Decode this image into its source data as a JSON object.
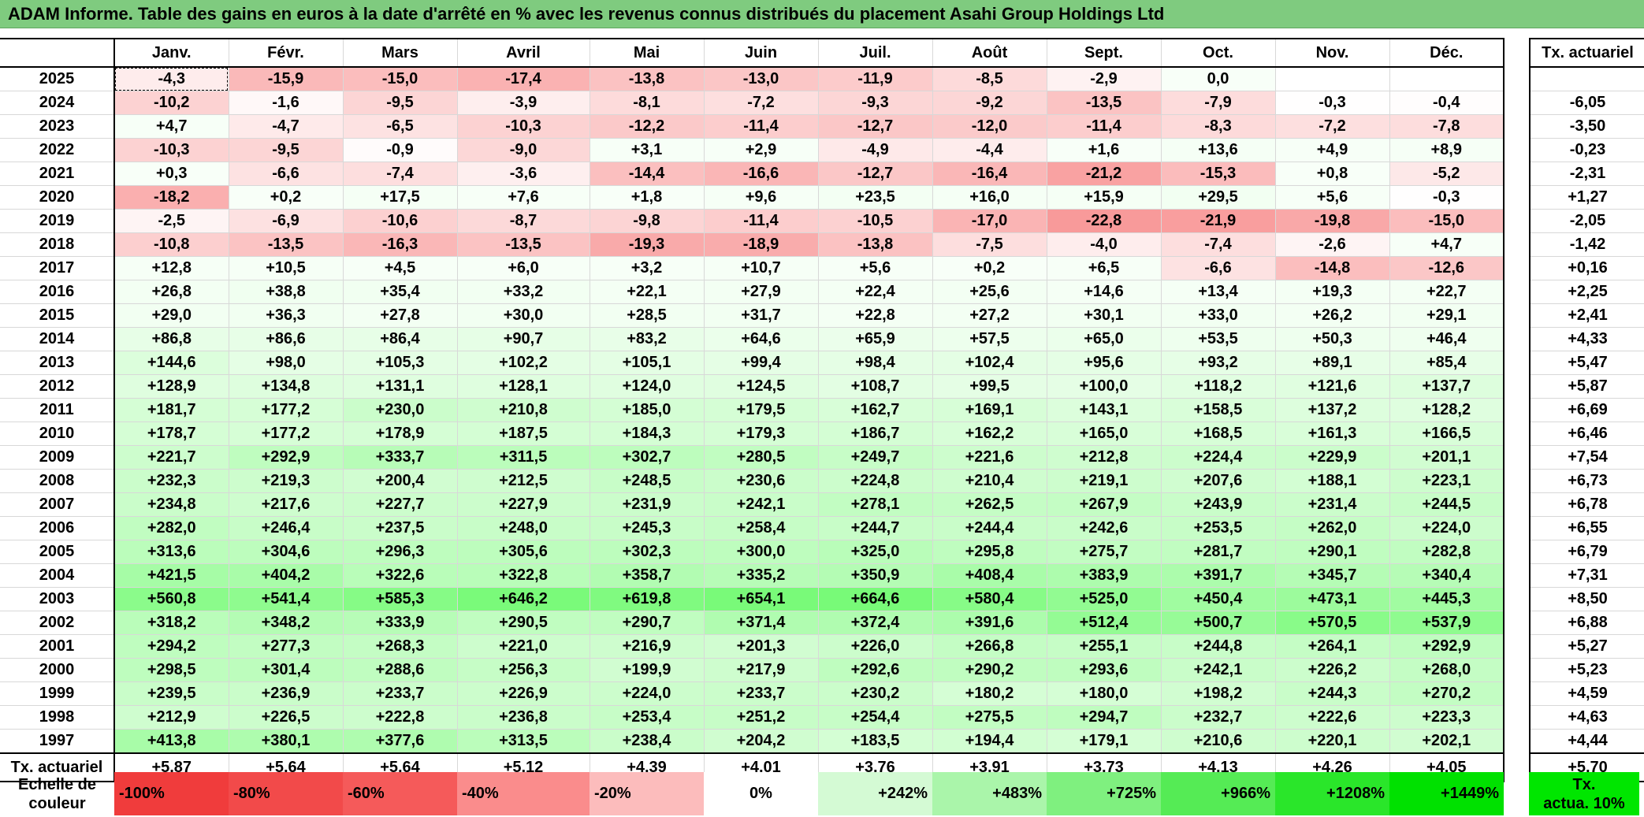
{
  "title": "ADAM Informe. Table des gains en euros à la date d'arrêté en % avec les revenus connus distribués du placement Asahi Group Holdings Ltd",
  "months": [
    "Janv.",
    "Févr.",
    "Mars",
    "Avril",
    "Mai",
    "Juin",
    "Juil.",
    "Août",
    "Sept.",
    "Oct.",
    "Nov.",
    "Déc."
  ],
  "actuarial_header": "Tx. actuariel",
  "rows": [
    {
      "year": "2025",
      "values": [
        "-4,3",
        "-15,9",
        "-15,0",
        "-17,4",
        "-13,8",
        "-13,0",
        "-11,9",
        "-8,5",
        "-2,9",
        "0,0",
        "",
        ""
      ],
      "rate": ""
    },
    {
      "year": "2024",
      "values": [
        "-10,2",
        "-1,6",
        "-9,5",
        "-3,9",
        "-8,1",
        "-7,2",
        "-9,3",
        "-9,2",
        "-13,5",
        "-7,9",
        "-0,3",
        "-0,4"
      ],
      "rate": "-6,05"
    },
    {
      "year": "2023",
      "values": [
        "+4,7",
        "-4,7",
        "-6,5",
        "-10,3",
        "-12,2",
        "-11,4",
        "-12,7",
        "-12,0",
        "-11,4",
        "-8,3",
        "-7,2",
        "-7,8"
      ],
      "rate": "-3,50"
    },
    {
      "year": "2022",
      "values": [
        "-10,3",
        "-9,5",
        "-0,9",
        "-9,0",
        "+3,1",
        "+2,9",
        "-4,9",
        "-4,4",
        "+1,6",
        "+13,6",
        "+4,9",
        "+8,9"
      ],
      "rate": "-0,23"
    },
    {
      "year": "2021",
      "values": [
        "+0,3",
        "-6,6",
        "-7,4",
        "-3,6",
        "-14,4",
        "-16,6",
        "-12,7",
        "-16,4",
        "-21,2",
        "-15,3",
        "+0,8",
        "-5,2"
      ],
      "rate": "-2,31"
    },
    {
      "year": "2020",
      "values": [
        "-18,2",
        "+0,2",
        "+17,5",
        "+7,6",
        "+1,8",
        "+9,6",
        "+23,5",
        "+16,0",
        "+15,9",
        "+29,5",
        "+5,6",
        "-0,3"
      ],
      "rate": "+1,27"
    },
    {
      "year": "2019",
      "values": [
        "-2,5",
        "-6,9",
        "-10,6",
        "-8,7",
        "-9,8",
        "-11,4",
        "-10,5",
        "-17,0",
        "-22,8",
        "-21,9",
        "-19,8",
        "-15,0"
      ],
      "rate": "-2,05"
    },
    {
      "year": "2018",
      "values": [
        "-10,8",
        "-13,5",
        "-16,3",
        "-13,5",
        "-19,3",
        "-18,9",
        "-13,8",
        "-7,5",
        "-4,0",
        "-7,4",
        "-2,6",
        "+4,7"
      ],
      "rate": "-1,42"
    },
    {
      "year": "2017",
      "values": [
        "+12,8",
        "+10,5",
        "+4,5",
        "+6,0",
        "+3,2",
        "+10,7",
        "+5,6",
        "+0,2",
        "+6,5",
        "-6,6",
        "-14,8",
        "-12,6"
      ],
      "rate": "+0,16"
    },
    {
      "year": "2016",
      "values": [
        "+26,8",
        "+38,8",
        "+35,4",
        "+33,2",
        "+22,1",
        "+27,9",
        "+22,4",
        "+25,6",
        "+14,6",
        "+13,4",
        "+19,3",
        "+22,7"
      ],
      "rate": "+2,25"
    },
    {
      "year": "2015",
      "values": [
        "+29,0",
        "+36,3",
        "+27,8",
        "+30,0",
        "+28,5",
        "+31,7",
        "+22,8",
        "+27,2",
        "+30,1",
        "+33,0",
        "+26,2",
        "+29,1"
      ],
      "rate": "+2,41"
    },
    {
      "year": "2014",
      "values": [
        "+86,8",
        "+86,6",
        "+86,4",
        "+90,7",
        "+83,2",
        "+64,6",
        "+65,9",
        "+57,5",
        "+65,0",
        "+53,5",
        "+50,3",
        "+46,4"
      ],
      "rate": "+4,33"
    },
    {
      "year": "2013",
      "values": [
        "+144,6",
        "+98,0",
        "+105,3",
        "+102,2",
        "+105,1",
        "+99,4",
        "+98,4",
        "+102,4",
        "+95,6",
        "+93,2",
        "+89,1",
        "+85,4"
      ],
      "rate": "+5,47"
    },
    {
      "year": "2012",
      "values": [
        "+128,9",
        "+134,8",
        "+131,1",
        "+128,1",
        "+124,0",
        "+124,5",
        "+108,7",
        "+99,5",
        "+100,0",
        "+118,2",
        "+121,6",
        "+137,7"
      ],
      "rate": "+5,87"
    },
    {
      "year": "2011",
      "values": [
        "+181,7",
        "+177,2",
        "+230,0",
        "+210,8",
        "+185,0",
        "+179,5",
        "+162,7",
        "+169,1",
        "+143,1",
        "+158,5",
        "+137,2",
        "+128,2"
      ],
      "rate": "+6,69"
    },
    {
      "year": "2010",
      "values": [
        "+178,7",
        "+177,2",
        "+178,9",
        "+187,5",
        "+184,3",
        "+179,3",
        "+186,7",
        "+162,2",
        "+165,0",
        "+168,5",
        "+161,3",
        "+166,5"
      ],
      "rate": "+6,46"
    },
    {
      "year": "2009",
      "values": [
        "+221,7",
        "+292,9",
        "+333,7",
        "+311,5",
        "+302,7",
        "+280,5",
        "+249,7",
        "+221,6",
        "+212,8",
        "+224,4",
        "+229,9",
        "+201,1"
      ],
      "rate": "+7,54"
    },
    {
      "year": "2008",
      "values": [
        "+232,3",
        "+219,3",
        "+200,4",
        "+212,5",
        "+248,5",
        "+230,6",
        "+224,8",
        "+210,4",
        "+219,1",
        "+207,6",
        "+188,1",
        "+223,1"
      ],
      "rate": "+6,73"
    },
    {
      "year": "2007",
      "values": [
        "+234,8",
        "+217,6",
        "+227,7",
        "+227,9",
        "+231,9",
        "+242,1",
        "+278,1",
        "+262,5",
        "+267,9",
        "+243,9",
        "+231,4",
        "+244,5"
      ],
      "rate": "+6,78"
    },
    {
      "year": "2006",
      "values": [
        "+282,0",
        "+246,4",
        "+237,5",
        "+248,0",
        "+245,3",
        "+258,4",
        "+244,7",
        "+244,4",
        "+242,6",
        "+253,5",
        "+262,0",
        "+224,0"
      ],
      "rate": "+6,55"
    },
    {
      "year": "2005",
      "values": [
        "+313,6",
        "+304,6",
        "+296,3",
        "+305,6",
        "+302,3",
        "+300,0",
        "+325,0",
        "+295,8",
        "+275,7",
        "+281,7",
        "+290,1",
        "+282,8"
      ],
      "rate": "+6,79"
    },
    {
      "year": "2004",
      "values": [
        "+421,5",
        "+404,2",
        "+322,6",
        "+322,8",
        "+358,7",
        "+335,2",
        "+350,9",
        "+408,4",
        "+383,9",
        "+391,7",
        "+345,7",
        "+340,4"
      ],
      "rate": "+7,31"
    },
    {
      "year": "2003",
      "values": [
        "+560,8",
        "+541,4",
        "+585,3",
        "+646,2",
        "+619,8",
        "+654,1",
        "+664,6",
        "+580,4",
        "+525,0",
        "+450,4",
        "+473,1",
        "+445,3"
      ],
      "rate": "+8,50"
    },
    {
      "year": "2002",
      "values": [
        "+318,2",
        "+348,2",
        "+333,9",
        "+290,5",
        "+290,7",
        "+371,4",
        "+372,4",
        "+391,6",
        "+512,4",
        "+500,7",
        "+570,5",
        "+537,9"
      ],
      "rate": "+6,88"
    },
    {
      "year": "2001",
      "values": [
        "+294,2",
        "+277,3",
        "+268,3",
        "+221,0",
        "+216,9",
        "+201,3",
        "+226,0",
        "+266,8",
        "+255,1",
        "+244,8",
        "+264,1",
        "+292,9"
      ],
      "rate": "+5,27"
    },
    {
      "year": "2000",
      "values": [
        "+298,5",
        "+301,4",
        "+288,6",
        "+256,3",
        "+199,9",
        "+217,9",
        "+292,6",
        "+290,2",
        "+293,6",
        "+242,1",
        "+226,2",
        "+268,0"
      ],
      "rate": "+5,23"
    },
    {
      "year": "1999",
      "values": [
        "+239,5",
        "+236,9",
        "+233,7",
        "+226,9",
        "+224,0",
        "+233,7",
        "+230,2",
        "+180,2",
        "+180,0",
        "+198,2",
        "+244,3",
        "+270,2"
      ],
      "rate": "+4,59"
    },
    {
      "year": "1998",
      "values": [
        "+212,9",
        "+226,5",
        "+222,8",
        "+236,8",
        "+253,4",
        "+251,2",
        "+254,4",
        "+275,5",
        "+294,7",
        "+232,7",
        "+222,6",
        "+223,3"
      ],
      "rate": "+4,63"
    },
    {
      "year": "1997",
      "values": [
        "+413,8",
        "+380,1",
        "+377,6",
        "+313,5",
        "+238,4",
        "+204,2",
        "+183,5",
        "+194,4",
        "+179,1",
        "+210,6",
        "+220,1",
        "+202,1"
      ],
      "rate": "+4,44"
    }
  ],
  "footer": {
    "label": "Tx. actuariel",
    "values": [
      "+5,87",
      "+5,64",
      "+5,64",
      "+5,12",
      "+4,39",
      "+4,01",
      "+3,76",
      "+3,91",
      "+3,73",
      "+4,13",
      "+4,26",
      "+4,05"
    ],
    "rate": "+5,70"
  },
  "scale": {
    "label_line1": "Echelle de",
    "label_line2": "couleur",
    "steps": [
      {
        "label": "-100%",
        "color": "#f03c3c"
      },
      {
        "label": "-80%",
        "color": "#f24a4a"
      },
      {
        "label": "-60%",
        "color": "#f55a5a"
      },
      {
        "label": "-40%",
        "color": "#fa8c8c"
      },
      {
        "label": "-20%",
        "color": "#fcbcbc"
      },
      {
        "label": "0%",
        "color": "#ffffff"
      },
      {
        "label": "+242%",
        "color": "#d4fad4"
      },
      {
        "label": "+483%",
        "color": "#aaf5aa"
      },
      {
        "label": "+725%",
        "color": "#7ff07f"
      },
      {
        "label": "+966%",
        "color": "#55eb55"
      },
      {
        "label": "+1208%",
        "color": "#2ae62a"
      },
      {
        "label": "+1449%",
        "color": "#00e100"
      }
    ],
    "actuarial_line1": "Tx.",
    "actuarial_line2": "actua. 10%",
    "actuarial_color": "#00e600"
  },
  "colors": {
    "title_bar": "#7fcb7f",
    "negative_full": "#f03c3c",
    "positive_full": "#00e100"
  }
}
